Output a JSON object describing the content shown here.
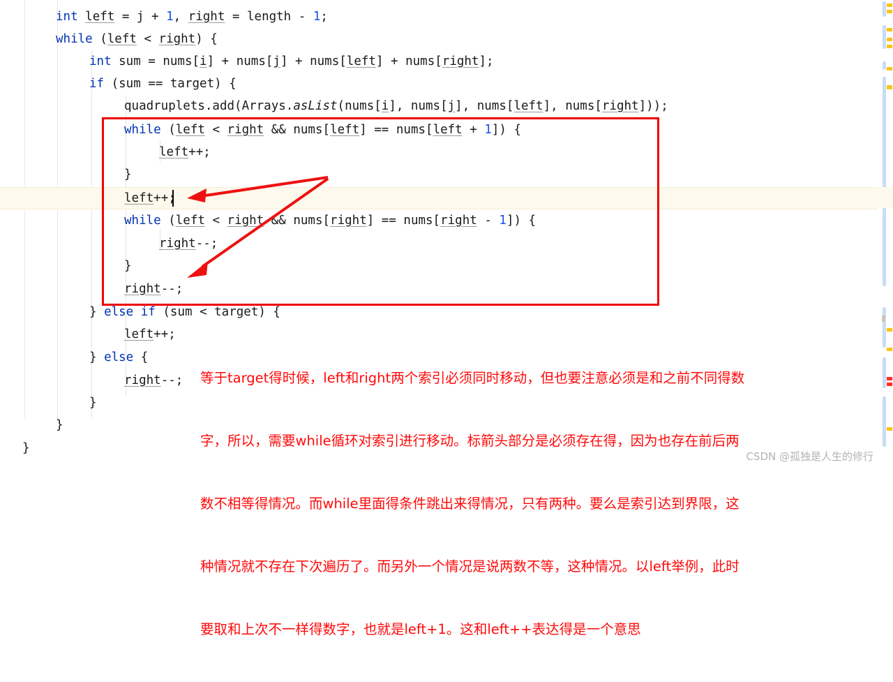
{
  "editor": {
    "language": "java",
    "colors": {
      "keyword": "#0033b3",
      "number": "#1750eb",
      "text": "#1a1a1a",
      "annotation_red": "#ff0a0a",
      "box_red": "#ee0000",
      "current_line_highlight": "#fdf9ec",
      "indent_guide": "#e3e3e3",
      "gutter_line": "#e8e8e8",
      "scrollbar_thumb": "#c8ddf5",
      "warning_marker": "#f5c518",
      "watermark": "#b3b3b3"
    },
    "lines": [
      {
        "n": 1,
        "indent": 80,
        "text": "int left = j + 1, right = length - 1;"
      },
      {
        "n": 2,
        "indent": 80,
        "text": "while (left < right) {"
      },
      {
        "n": 3,
        "indent": 128,
        "text": "int sum = nums[i] + nums[j] + nums[left] + nums[right];"
      },
      {
        "n": 4,
        "indent": 128,
        "text": "if (sum == target) {"
      },
      {
        "n": 5,
        "indent": 178,
        "text": "quadruplets.add(Arrays.asList(nums[i], nums[j], nums[left], nums[right]));"
      },
      {
        "n": 6,
        "indent": 178,
        "text": "while (left < right && nums[left] == nums[left + 1]) {"
      },
      {
        "n": 7,
        "indent": 228,
        "text": "left++;"
      },
      {
        "n": 8,
        "indent": 178,
        "text": "}"
      },
      {
        "n": 9,
        "indent": 178,
        "text": "left++;"
      },
      {
        "n": 10,
        "indent": 178,
        "text": "while (left < right && nums[right] == nums[right - 1]) {"
      },
      {
        "n": 11,
        "indent": 228,
        "text": "right--;"
      },
      {
        "n": 12,
        "indent": 178,
        "text": "}"
      },
      {
        "n": 13,
        "indent": 178,
        "text": "right--;"
      },
      {
        "n": 14,
        "indent": 128,
        "text": "} else if (sum < target) {"
      },
      {
        "n": 15,
        "indent": 178,
        "text": "left++;"
      },
      {
        "n": 16,
        "indent": 128,
        "text": "} else {"
      },
      {
        "n": 17,
        "indent": 178,
        "text": "right--;"
      },
      {
        "n": 18,
        "indent": 128,
        "text": "}"
      },
      {
        "n": 19,
        "indent": 80,
        "text": "}"
      },
      {
        "n": 20,
        "indent": 32,
        "text": "}"
      }
    ],
    "current_line": 9,
    "caret_line": 9,
    "caret_after_text": "left++"
  },
  "annotation": {
    "red_box_label": "highlight-box-around-duplicate-skip-loops",
    "arrows": [
      {
        "label": "arrow-to-left-increment",
        "target": "left++;"
      },
      {
        "label": "arrow-to-right-decrement",
        "target": "right--;"
      }
    ],
    "note_lines": [
      "等于target得时候，left和right两个索引必须同时移动，但也要注意必须是和之前不同得数",
      "字，所以，需要while循环对索引进行移动。标箭头部分是必须存在得，因为也存在前后两",
      "数不相等得情况。而while里面得条件跳出来得情况，只有两种。要么是索引达到界限，这",
      "种情况就不存在下次遍历了。而另外一个情况是说两数不等，这种情况。以left举例，此时",
      "要取和上次不一样得数字，也就是left+1。这和left++表达得是一个意思"
    ]
  },
  "watermark": {
    "text": "CSDN @孤独是人生的修行"
  }
}
